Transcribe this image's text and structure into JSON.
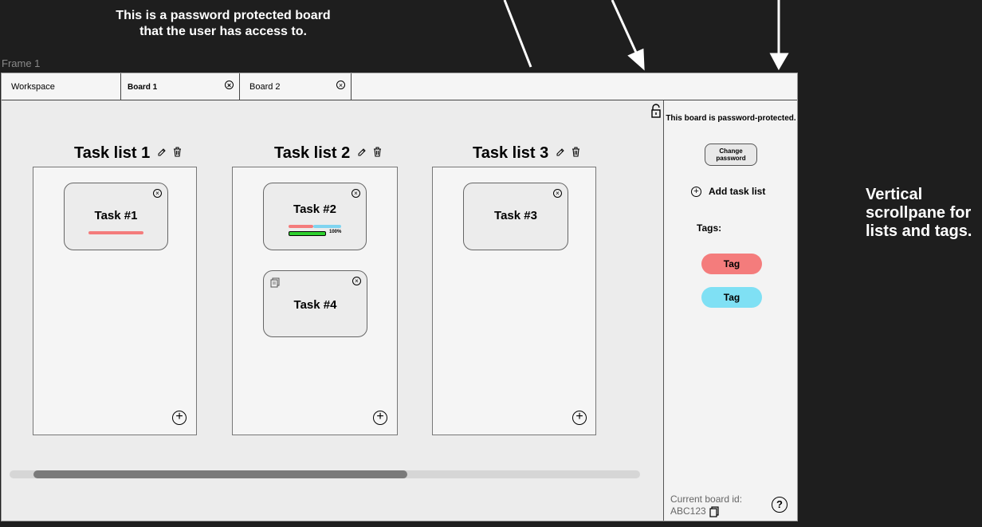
{
  "annotations": {
    "top_note": "This is a password protected board that the user has access to.",
    "right_note": "Vertical scrollpane for lists and tags."
  },
  "frame_label": "Frame 1",
  "tabs": [
    {
      "label": "Workspace"
    },
    {
      "label": "Board 1",
      "active": true
    },
    {
      "label": "Board 2"
    }
  ],
  "lists": [
    {
      "title": "Task list 1",
      "cards": [
        {
          "title": "Task #1"
        }
      ]
    },
    {
      "title": "Task list 2",
      "cards": [
        {
          "title": "Task #2",
          "progress_label": "100%",
          "progress": 1.0
        },
        {
          "title": "Task #4"
        }
      ]
    },
    {
      "title": "Task list 3",
      "cards": [
        {
          "title": "Task #3"
        }
      ]
    }
  ],
  "sidebar": {
    "protected_note": "This board is password-protected.",
    "change_password": "Change password",
    "add_task_list": "Add task list",
    "tags_label": "Tags:",
    "tags": [
      {
        "label": "Tag",
        "color": "#f47c7c"
      },
      {
        "label": "Tag",
        "color": "#7fe0f4"
      }
    ],
    "board_id_label": "Current board id:",
    "board_id": "ABC123"
  },
  "colors": {
    "progress_red": "#f47c7c",
    "progress_blue": "#7fd4f0",
    "progress_green": "#2fd12f"
  }
}
